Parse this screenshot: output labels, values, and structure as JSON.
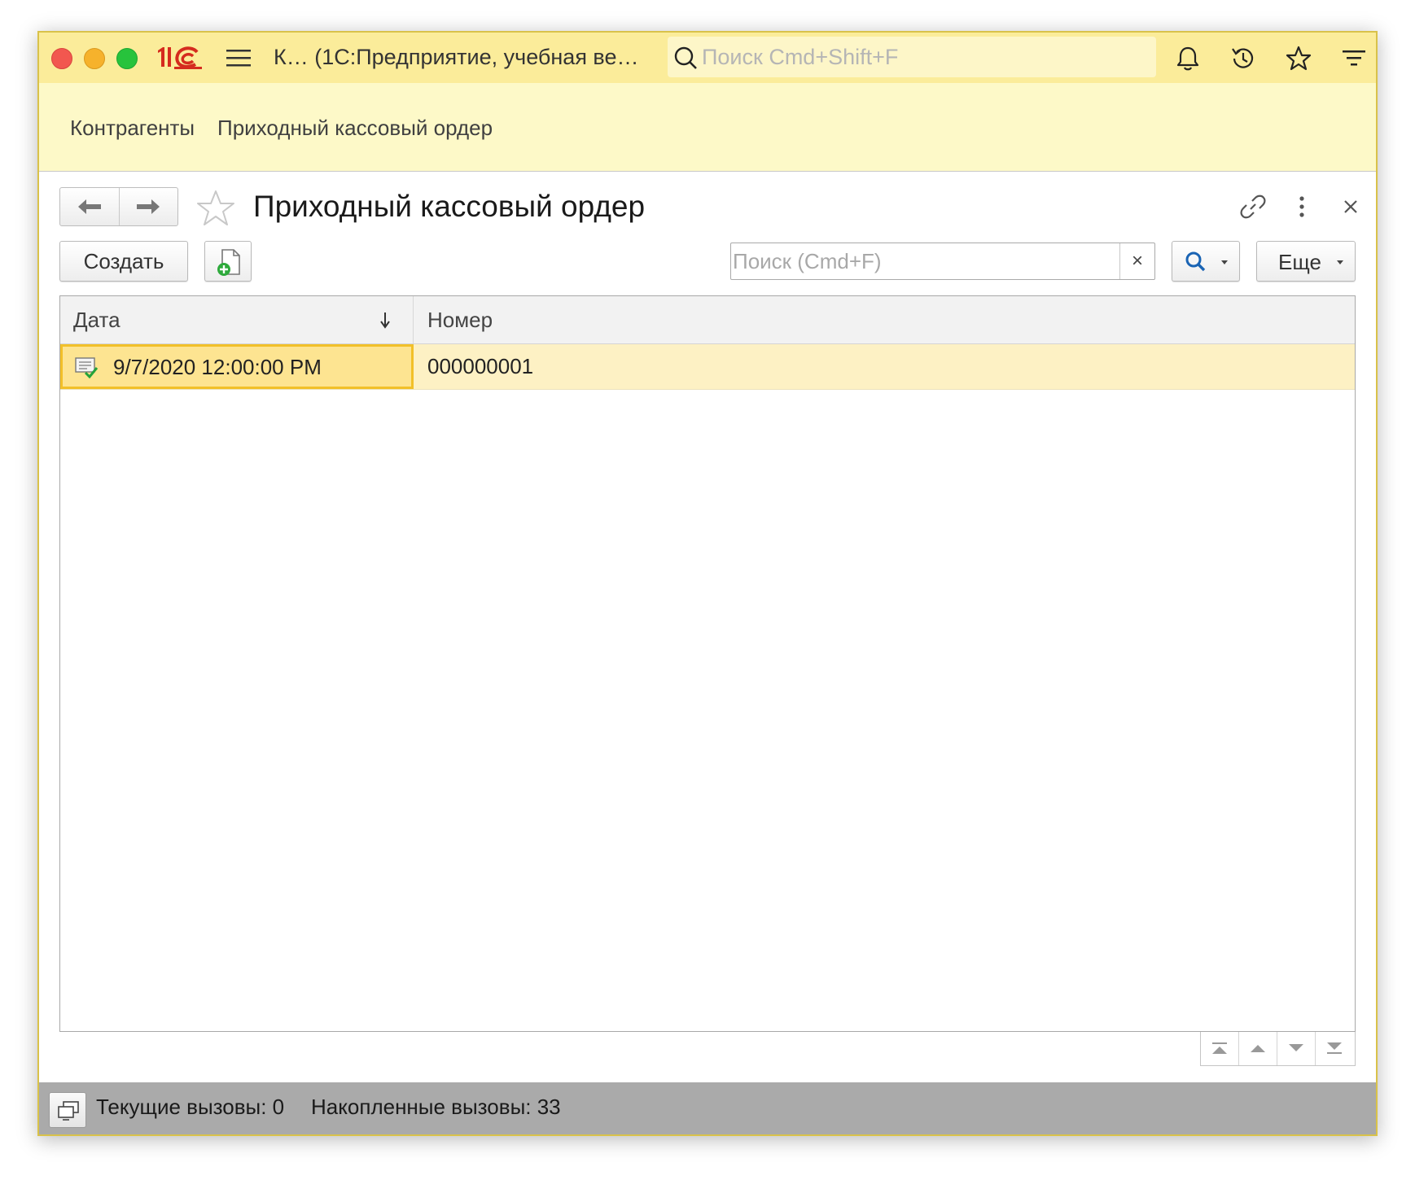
{
  "window": {
    "app_title": "К… (1С:Предприятие, учебная ве…",
    "global_search_placeholder": "Поиск Cmd+Shift+F",
    "icons": [
      "close-window-icon",
      "minimize-window-icon",
      "maximize-window-icon",
      "1c-logo-icon",
      "main-menu-icon",
      "search-icon",
      "bell-icon",
      "history-icon",
      "star-icon",
      "funnel-icon"
    ]
  },
  "sections": [
    {
      "label": "Контрагенты"
    },
    {
      "label": "Приходный кассовый ордер"
    }
  ],
  "form": {
    "title": "Приходный кассовый ордер",
    "icons": [
      "back-arrow-icon",
      "forward-arrow-icon",
      "favorite-star-icon",
      "link-icon",
      "more-vertical-icon",
      "close-icon"
    ]
  },
  "toolbar": {
    "create_label": "Создать",
    "copy_icon": "add-document-icon",
    "search_placeholder": "Поиск (Cmd+F)",
    "clear_label": "×",
    "search_mode_icon": "search-icon",
    "more_label": "Еще"
  },
  "table": {
    "columns": [
      {
        "label": "Дата",
        "sort": "descending"
      },
      {
        "label": "Номер"
      }
    ],
    "rows": [
      {
        "date": "9/7/2020 12:00:00 PM",
        "number": "000000001",
        "status_icon": "posted-document-icon",
        "selected": true
      }
    ],
    "scroll_icons": [
      "scroll-to-top-icon",
      "scroll-up-icon",
      "scroll-down-icon",
      "scroll-to-bottom-icon"
    ]
  },
  "statusbar": {
    "icon": "server-calls-icon",
    "current_calls": "Текущие вызовы: 0",
    "accumulated_calls": "Накопленные вызовы: 33"
  },
  "colors": {
    "titlebar": "#fbec9a",
    "sectionbar": "#fdf9c8",
    "selected_row": "#fdf1c4",
    "selected_cell": "#fde491",
    "selected_border": "#f2c029",
    "statusbar": "#aaaaaa"
  }
}
